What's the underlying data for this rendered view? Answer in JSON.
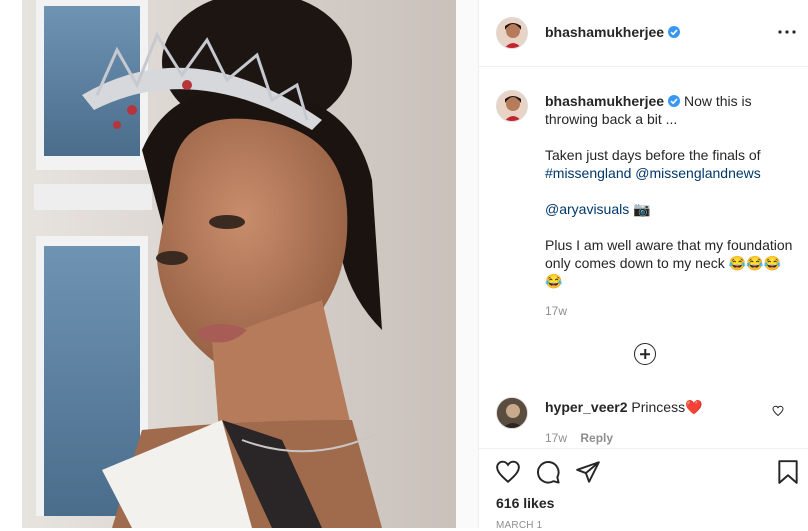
{
  "post": {
    "username": "bhashamukherjee",
    "caption_parts": [
      "Now this is throwing back a bit ...",
      "Taken just days before the finals of",
      "#missengland",
      "@missenglandnews",
      "@aryavisuals",
      "📷",
      "Plus I am well aware that my foundation only comes down to my neck",
      "😂😂😂😂"
    ],
    "caption_age": "17w",
    "likes": "616 likes",
    "date": "MARCH 1"
  },
  "comments": [
    {
      "username": "hyper_veer2",
      "text": "Princess",
      "emoji": "❤️",
      "age": "17w",
      "reply_label": "Reply"
    }
  ],
  "colors": {
    "accent": "#3897f0",
    "link": "#00376b",
    "heart": "#ed4956"
  },
  "icons": [
    "verified-icon",
    "more-options-icon",
    "load-more-comments-icon",
    "like-icon",
    "comment-icon",
    "share-icon",
    "save-icon",
    "comment-like-icon"
  ]
}
